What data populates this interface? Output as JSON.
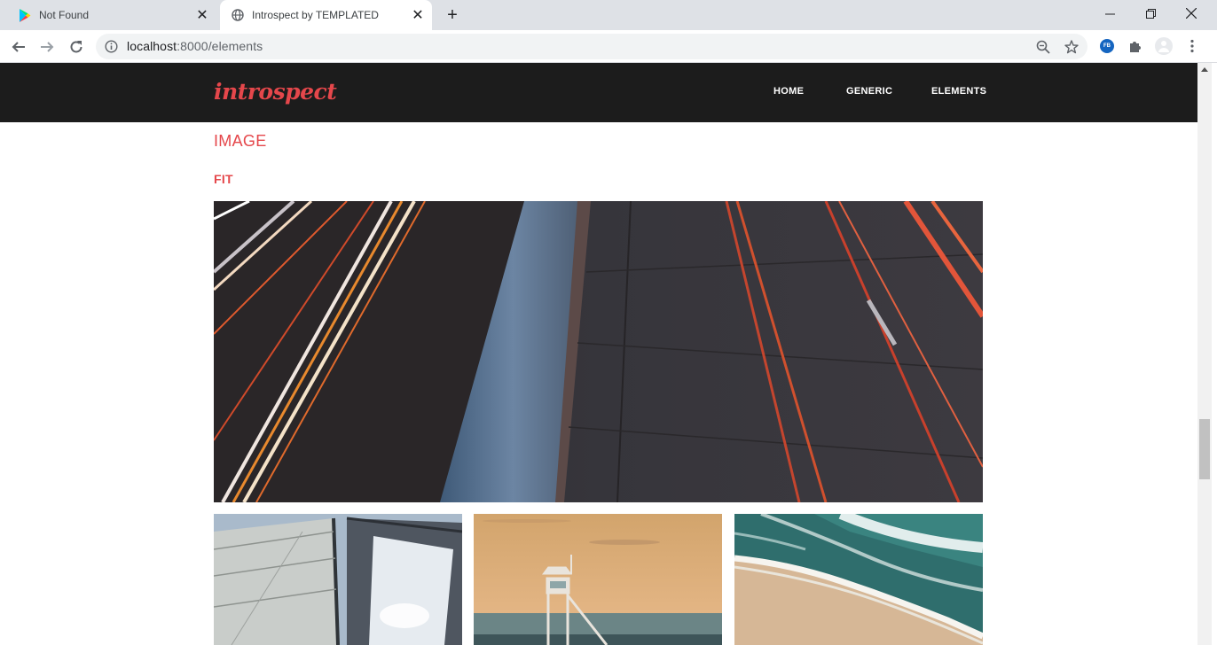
{
  "browser": {
    "tabs": [
      {
        "title": "Not Found",
        "icon": "google-play-icon",
        "active": false
      },
      {
        "title": "Introspect by TEMPLATED",
        "icon": "globe-icon",
        "active": true
      }
    ],
    "address": {
      "host": "localhost",
      "rest": ":8000/elements"
    }
  },
  "site": {
    "logo": "introspect",
    "nav": [
      "HOME",
      "GENERIC",
      "ELEMENTS"
    ],
    "accent_color": "#e5474b",
    "header_color": "#1c1c1c"
  },
  "content": {
    "section_heading": "IMAGE",
    "sub_heading": "FIT",
    "images": [
      {
        "name": "highway-light-trails",
        "icon": "photo-icon"
      },
      {
        "name": "sailboat-sail",
        "icon": "photo-icon"
      },
      {
        "name": "lifeguard-tower",
        "icon": "photo-icon"
      },
      {
        "name": "beach-waves",
        "icon": "photo-icon"
      }
    ]
  }
}
